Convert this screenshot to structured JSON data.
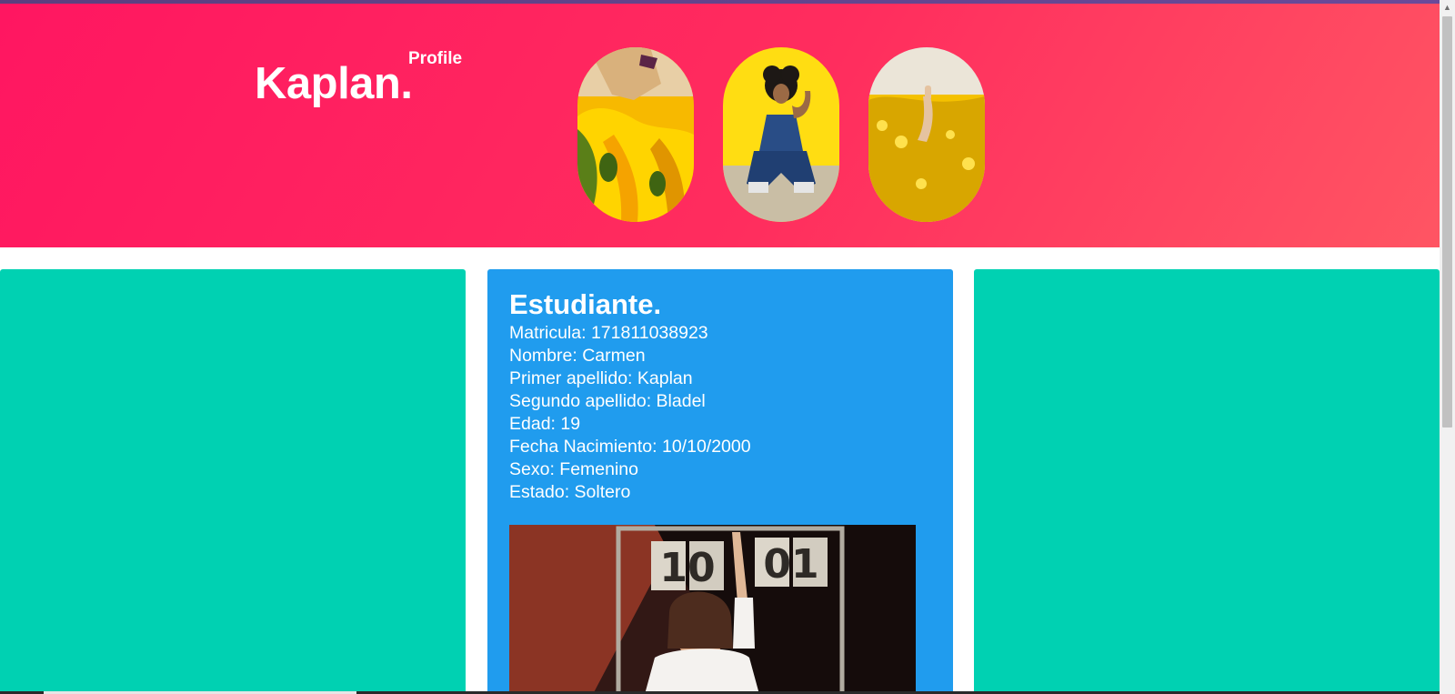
{
  "header": {
    "brand": "Kaplan.",
    "subtitle": "Profile"
  },
  "gallery": [
    {
      "name": "yellow-flowers-portrait"
    },
    {
      "name": "crouching-woman-yellow-backdrop"
    },
    {
      "name": "hand-in-rapeseed-field"
    }
  ],
  "student": {
    "title": "Estudiante.",
    "fields": [
      "Matricula: 171811038923",
      "Nombre: Carmen",
      "Primer apellido: Kaplan",
      "Segundo apellido: Bladel",
      "Edad: 19",
      "Fecha Nacimiento: 10/10/2000",
      "Sexo: Femenino",
      "Estado: Soltero"
    ],
    "photo_cards": [
      "10",
      "01"
    ]
  },
  "colors": {
    "hero_start": "#ff1661",
    "hero_end": "#ff5563",
    "primary_column": "#00d1b2",
    "info_column": "#209cee",
    "text": "#ffffff"
  },
  "icons": {
    "scroll_up": "▲"
  }
}
